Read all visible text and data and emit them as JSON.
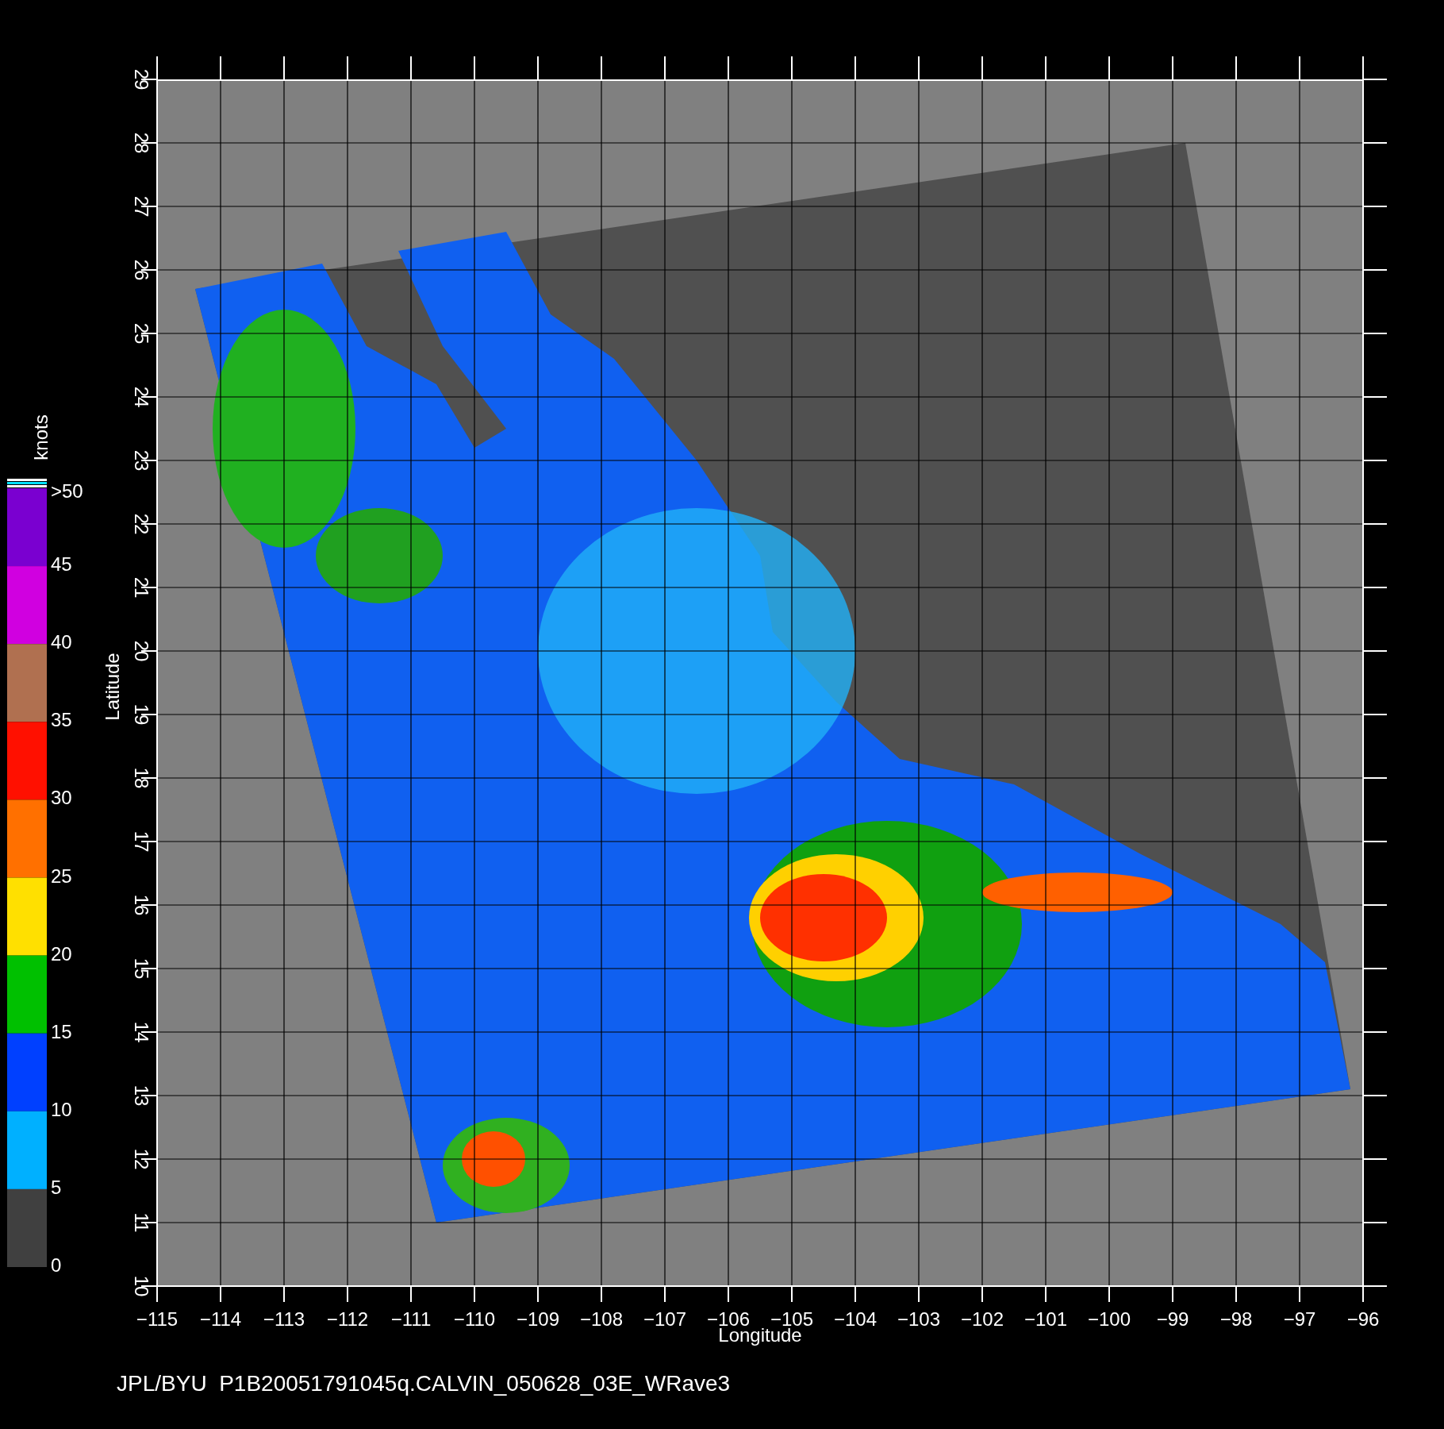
{
  "map": {
    "xlabel": "Longitude",
    "ylabel": "Latitude",
    "xticks": [
      "−115",
      "−114",
      "−113",
      "−112",
      "−111",
      "−110",
      "−109",
      "−108",
      "−107",
      "−106",
      "−105",
      "−104",
      "−103",
      "−102",
      "−101",
      "−100",
      "−99",
      "−98",
      "−97",
      "−96"
    ],
    "yticks": [
      "10",
      "11",
      "12",
      "13",
      "14",
      "15",
      "16",
      "17",
      "18",
      "19",
      "20",
      "21",
      "22",
      "23",
      "24",
      "25",
      "26",
      "27",
      "28",
      "29"
    ]
  },
  "colorbar": {
    "unit": "knots",
    "labels": [
      ">50",
      "45",
      "40",
      "35",
      "30",
      "25",
      "20",
      "15",
      "10",
      "5",
      "0"
    ],
    "segments": [
      {
        "color": "#7a00d0"
      },
      {
        "color": "#d000e0"
      },
      {
        "color": "#b07050"
      },
      {
        "color": "#ff1000"
      },
      {
        "color": "#ff7000"
      },
      {
        "color": "#ffe000"
      },
      {
        "color": "#00c000"
      },
      {
        "color": "#0040ff"
      },
      {
        "color": "#00b0ff"
      },
      {
        "color": "#404040"
      }
    ]
  },
  "footer": "JPL/BYU  P1B20051791045q.CALVIN_050628_03E_WRave3"
}
